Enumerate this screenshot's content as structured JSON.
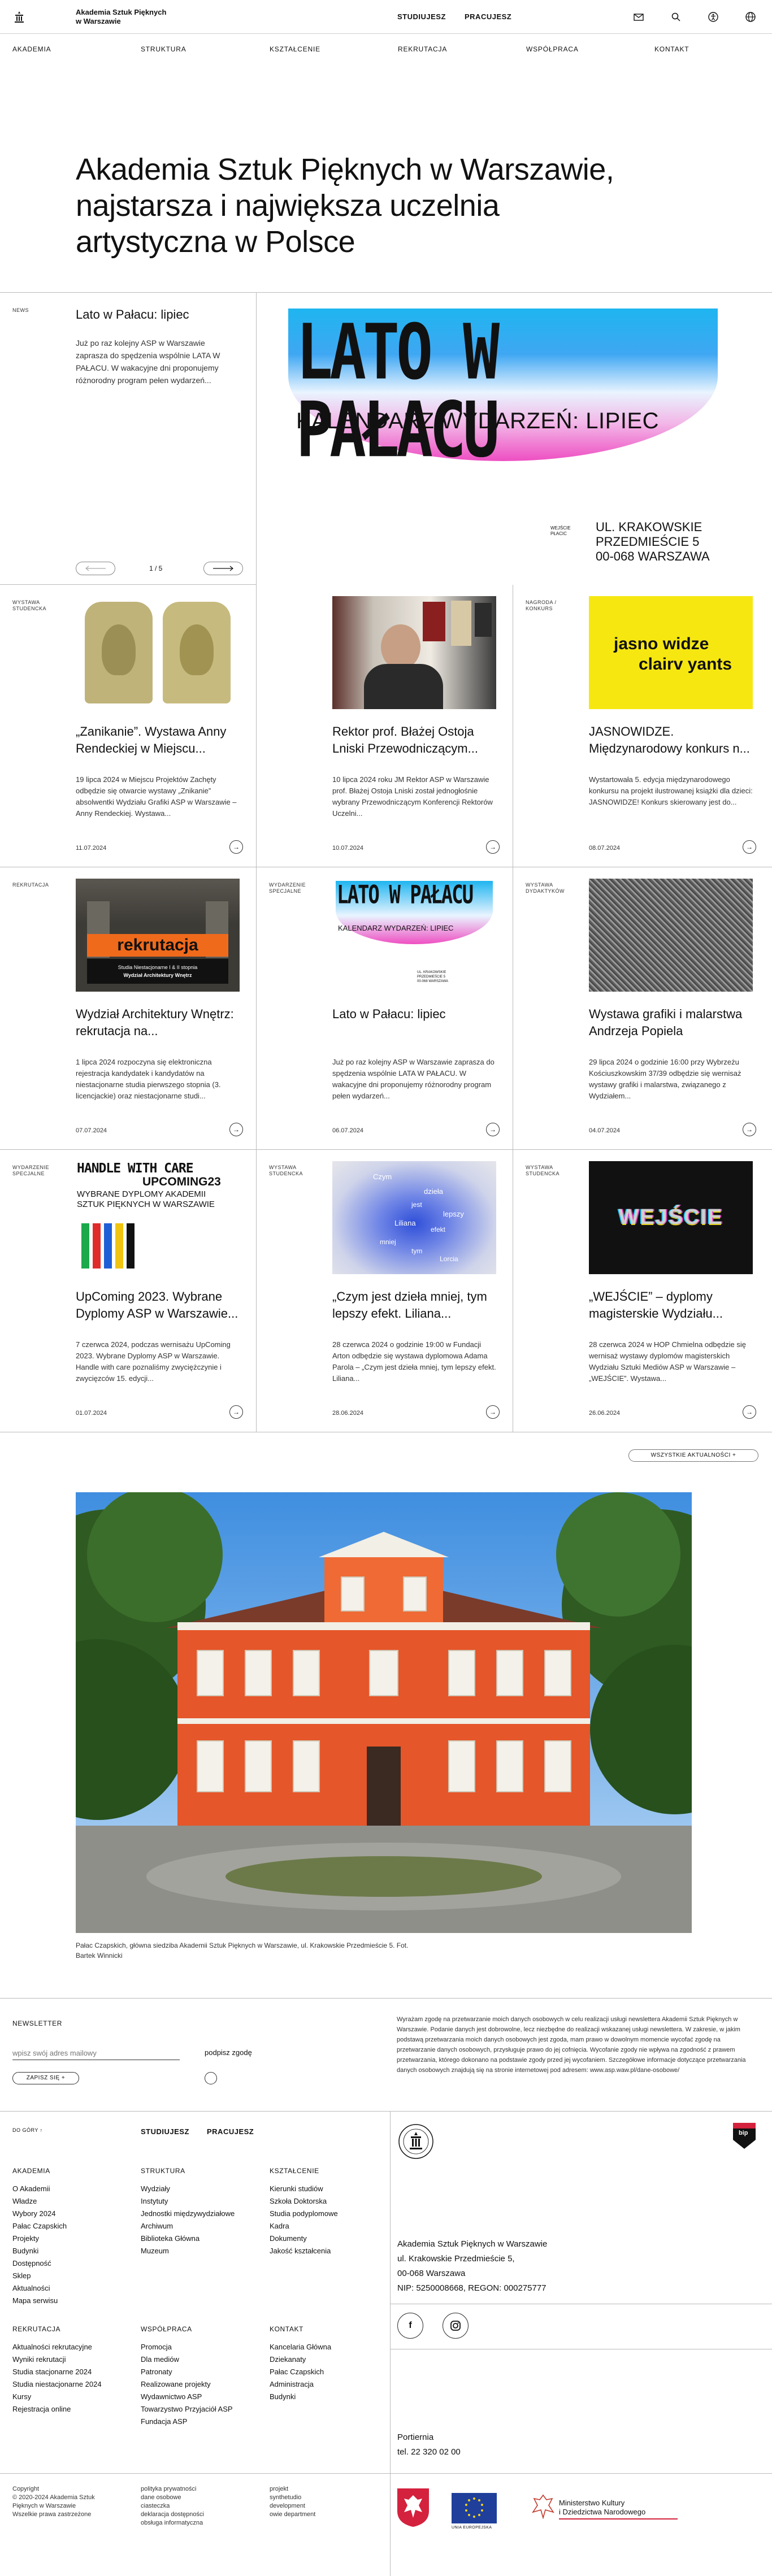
{
  "header": {
    "brand_line1": "Akademia Sztuk Pięknych",
    "brand_line2": "w Warszawie",
    "links": [
      "STUDIUJESZ",
      "PRACUJESZ"
    ]
  },
  "nav": [
    "AKADEMIA",
    "STRUKTURA",
    "KSZTAŁCENIE",
    "REKRUTACJA",
    "WSPÓŁPRACA",
    "KONTAKT"
  ],
  "hero": {
    "line1": "Akademia Sztuk Pięknych w Warszawie,",
    "line2": "najstarsza i największa uczelnia",
    "line3": "artystyczna w Polsce"
  },
  "featured": {
    "tag": "NEWS",
    "title": "Lato w Pałacu: lipiec",
    "excerpt": "Już po raz kolejny ASP w Warszawie zaprasza do spędzenia wspólnie LATA W PAŁACU. W wakacyjne dni proponujemy różnorodny program pełen wydarzeń...",
    "counter": "1 / 5",
    "banner_title": "LATO W PAŁACU",
    "banner_sub": "KALENDARZ WYDARZEŃ: LIPIEC",
    "banner_small1": "WEJŚCIE",
    "banner_small2": "PŁACIC",
    "banner_address1": "UL. KRAKOWSKIE",
    "banner_address2": "PRZEDMIEŚCIE 5",
    "banner_address3": "00-068 WARSZAWA"
  },
  "cards": [
    {
      "tag": "WYSTAWA STUDENCKA",
      "title": "„Zanikanie”. Wystawa Anny Rendeckiej w Miejscu...",
      "excerpt": "19 lipca 2024 w Miejscu Projektów Zachęty odbędzie się otwarcie wystawy „Znikanie” absolwentki Wydziału Grafiki ASP w Warszawie – Anny Rendeckiej. Wystawa...",
      "date": "11.07.2024"
    },
    {
      "tag": "",
      "title": "Rektor prof. Błażej Ostoja Lniski Przewodniczącym...",
      "excerpt": "10 lipca 2024 roku JM Rektor ASP w Warszawie prof. Błażej Ostoja Lniski został jednogłośnie wybrany Przewodniczącym Konferencji Rektorów Uczelni...",
      "date": "10.07.2024"
    },
    {
      "tag": "NAGRODA / KONKURS",
      "title": "JASNOWIDZE. Międzynarodowy konkurs n...",
      "excerpt": "Wystartowała 5. edycja międzynarodowego konkursu na projekt ilustrowanej książki dla dzieci: JASNOWIDZE! Konkurs skierowany jest do...",
      "date": "08.07.2024",
      "logo_line1": "jasno widze",
      "logo_line2": "clairv yants"
    },
    {
      "tag": "REKRUTACJA",
      "title": "Wydział Architektury Wnętrz: rekrutacja na...",
      "excerpt": "1 lipca 2024 rozpoczyna się elektroniczna rejestracja kandydatek i kandydatów na niestacjonarne studia pierwszego stopnia (3. licencjackie) oraz niestacjonarne studi...",
      "date": "07.07.2024",
      "img_big": "rekrutacja",
      "img_l1": "Studia Niestacjonarne I & II stopnia",
      "img_l2": "Wydział Architektury Wnętrz"
    },
    {
      "tag": "WYDARZENIE SPECJALNE",
      "title": "Lato w Pałacu: lipiec",
      "excerpt": "Już po raz kolejny ASP w Warszawie zaprasza do spędzenia wspólnie LATA W PAŁACU. W wakacyjne dni proponujemy różnorodny program pełen wydarzeń...",
      "date": "06.07.2024",
      "img_big": "LATO W PAŁACU",
      "img_sub": "KALENDARZ WYDARZEŃ: LIPIEC"
    },
    {
      "tag": "WYSTAWA DYDAKTYKÓW",
      "title": "Wystawa grafiki i malarstwa Andrzeja Popiela",
      "excerpt": "29 lipca 2024 o godzinie 16:00 przy Wybrzeżu Kościuszkowskim 37/39 odbędzie się wernisaż wystawy grafiki i malarstwa, związanego z Wydziałem...",
      "date": "04.07.2024"
    },
    {
      "tag": "WYDARZENIE SPECJALNE",
      "title": "UpComing 2023. Wybrane Dyplomy ASP w Warszawie...",
      "excerpt": "7 czerwca 2024, podczas wernisażu UpComing 2023. Wybrane Dyplomy ASP w Warszawie. Handle with care poznaliśmy zwyciężczynie i zwycięzców 15. edycji...",
      "date": "01.07.2024",
      "img_l1": "HANDLE WITH CARE",
      "img_l2": "UPCOMING23",
      "img_l3": "WYBRANE DYPLOMY AKADEMII",
      "img_l4": "SZTUK PIĘKNYCH W WARSZAWIE"
    },
    {
      "tag": "WYSTAWA STUDENCKA",
      "title": "„Czym jest dzieła mniej, tym lepszy efekt. Liliana...",
      "excerpt": "28 czerwca 2024 o godzinie 19:00 w Fundacji Arton odbędzie się wystawa dyplomowa Adama Parola – „Czym jest dzieła mniej, tym lepszy efekt. Liliana...",
      "date": "28.06.2024",
      "words": [
        "Czym",
        "dzieła",
        "jest",
        "lepszy",
        "Liliana",
        "efekt",
        "mniej",
        "Lorcia",
        "tym"
      ]
    },
    {
      "tag": "WYSTAWA STUDENCKA",
      "title": "„WEJŚCIE” – dyplomy magisterskie Wydziału...",
      "excerpt": "28 czerwca 2024 w HOP Chmielna odbędzie się wernisaż wystawy dyplomów magisterskich Wydziału Sztuki Mediów ASP w Warszawie – „WEJŚCIE”. Wystawa...",
      "date": "26.06.2024",
      "img_text": "WEJŚCIE"
    }
  ],
  "all_news": "WSZYSTKIE AKTUALNOŚCI  +",
  "photo_caption": "Pałac Czapskich, główna siedziba Akademii Sztuk Pięknych w Warszawie, ul. Krakowskie Przedmieście 5. Fot. Bartek Winnicki",
  "newsletter": {
    "heading": "NEWSLETTER",
    "placeholder": "wpisz swój adres mailowy",
    "consent": "podpisz zgodę",
    "button": "ZAPISZ SIĘ  +",
    "info": "Wyrażam zgodę na przetwarzanie moich danych osobowych w celu realizacji usługi newslettera Akademii Sztuk Pięknych w Warszawie. Podanie danych jest dobrowolne, lecz niezbędne do realizacji wskazanej usługi newslettera. W zakresie, w jakim podstawą przetwarzania moich danych osobowych jest zgoda, mam prawo w dowolnym momencie wycofać zgodę na przetwarzanie danych osobowych, przysługuje prawo do jej cofnięcia. Wycofanie zgody nie wpływa na zgodność z prawem przetwarzania, którego dokonano na podstawie zgody przed jej wycofaniem. Szczegółowe informacje dotyczące przetwarzania danych osobowych znajdują się na stronie internetowej pod adresem: www.asp.waw.pl/dane-osobowe/"
  },
  "footer": {
    "back_top": "DO GÓRY ↑",
    "top_links": [
      "STUDIUJESZ",
      "PRACUJESZ"
    ],
    "col_akademia": {
      "title": "AKADEMIA",
      "items": [
        "O Akademii",
        "Władze",
        "Wybory 2024",
        "Pałac Czapskich",
        "Projekty",
        "Budynki",
        "Dostępność",
        "Sklep",
        "Aktualności",
        "Mapa serwisu"
      ]
    },
    "col_struktura": {
      "title": "STRUKTURA",
      "items": [
        "Wydziały",
        "Instytuty",
        "Jednostki międzywydziałowe",
        "Archiwum",
        "Biblioteka Główna",
        "Muzeum"
      ]
    },
    "col_ksztalcenie": {
      "title": "KSZTAŁCENIE",
      "items": [
        "Kierunki studiów",
        "Szkoła Doktorska",
        "Studia podyplomowe",
        "Kadra",
        "Dokumenty",
        "Jakość kształcenia"
      ]
    },
    "col_rekrutacja": {
      "title": "REKRUTACJA",
      "items": [
        "Aktualności rekrutacyjne",
        "Wyniki rekrutacji",
        "Studia stacjonarne 2024",
        "Studia niestacjonarne 2024",
        "Kursy",
        "Rejestracja online"
      ]
    },
    "col_wspolpraca": {
      "title": "WSPÓŁPRACA",
      "items": [
        "Promocja",
        "Dla mediów",
        "Patronaty",
        "Realizowane projekty",
        "Wydawnictwo ASP",
        "Towarzystwo Przyjaciół ASP",
        "Fundacja ASP"
      ]
    },
    "col_kontakt": {
      "title": "KONTAKT",
      "items": [
        "Kancelaria Główna",
        "Dziekanaty",
        "Pałac Czapskich",
        "Administracja",
        "Budynki"
      ]
    },
    "address": [
      "Akademia Sztuk Pięknych w Warszawie",
      "ul. Krakowskie Przedmieście 5,",
      "00-068 Warszawa",
      "NIP: 5250008668, REGON: 000275777"
    ],
    "porter": [
      "Portiernia",
      "tel. 22 320 02 00"
    ],
    "copyright": [
      "Copyright",
      "© 2020-2024 Akademia Sztuk",
      "Pięknych w Warszawie",
      "Wszelkie prawa zastrzeżone"
    ],
    "legal": [
      "polityka prywatności",
      "dane osobowe",
      "ciasteczka",
      "deklaracja dostępności",
      "obsługa informatyczna"
    ],
    "credits": [
      "projekt",
      "synthetudio",
      "development",
      "owie department"
    ],
    "eu_label": "UNIA EUROPEJSKA",
    "ministry_line1": "Ministerstwo Kultury",
    "ministry_line2": "i Dziedzictwa Narodowego",
    "bip": "bip"
  }
}
